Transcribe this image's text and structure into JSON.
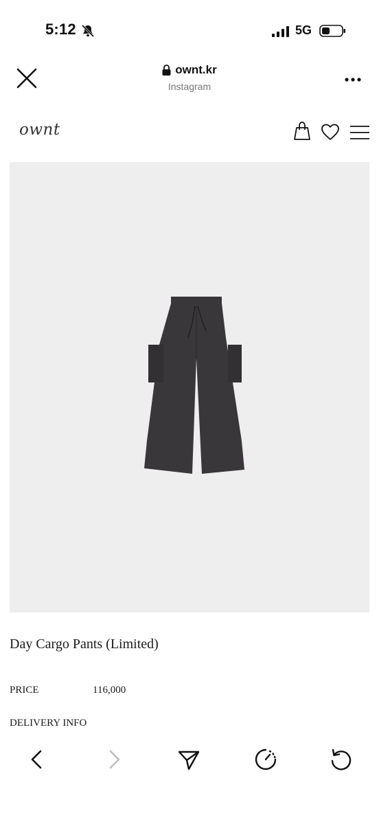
{
  "status_bar": {
    "time": "5:12",
    "network": "5G"
  },
  "browser": {
    "url": "ownt.kr",
    "source": "Instagram"
  },
  "site": {
    "logo": "ownt"
  },
  "product": {
    "title": "Day Cargo Pants (Limited)",
    "price_label": "PRICE",
    "price_value": "116,000",
    "delivery_label": "DELIVERY INFO"
  },
  "toolbar": {
    "icons": [
      "back-icon",
      "forward-icon",
      "share-icon",
      "speed-icon",
      "reload-icon"
    ]
  },
  "colors": {
    "image_bg": "#efeeee",
    "pants": "#3a373a",
    "forward_disabled": "#bdbdbd"
  }
}
